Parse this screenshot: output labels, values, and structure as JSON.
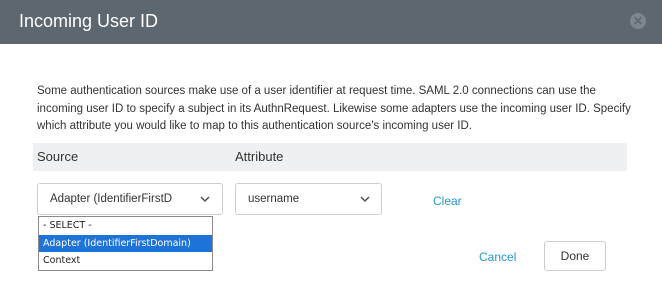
{
  "dialog": {
    "title": "Incoming User ID",
    "close_icon": "close-icon",
    "description": "Some authentication sources make use of a user identifier at request time. SAML 2.0 connections can use the incoming user ID to specify a subject in its AuthnRequest. Likewise some adapters use the incoming user ID. Specify which attribute you would like to map to this authentication source's incoming user ID."
  },
  "table": {
    "headers": {
      "source": "Source",
      "attribute": "Attribute"
    },
    "source_value": "Adapter (IdentifierFirstDomain)",
    "attribute_value": "username",
    "clear_label": "Clear"
  },
  "dropdown": {
    "options": [
      "- SELECT -",
      "Adapter (IdentifierFirstDomain)",
      "Context"
    ],
    "selected": "Adapter (IdentifierFirstDomain)"
  },
  "footer": {
    "cancel_label": "Cancel",
    "done_label": "Done"
  }
}
